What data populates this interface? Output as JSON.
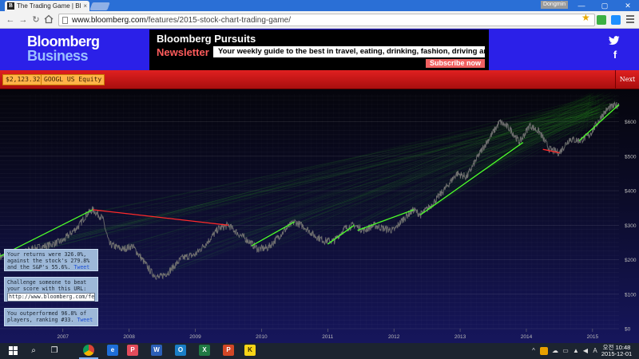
{
  "browser": {
    "tab_title": "The Trading Game | Bloo",
    "favicon_letter": "B",
    "tab_close": "×",
    "profile": "Dongmin",
    "url_host": "www.bloomberg.com",
    "url_path": "/features/2015-stock-chart-trading-game/",
    "back": "←",
    "forward": "→",
    "reload": "↻",
    "minimize": "—",
    "maximize": "▢",
    "close": "✕",
    "star": "★"
  },
  "site": {
    "logo_line1": "Bloomberg",
    "logo_line2": "Business",
    "twitter_icon": "t",
    "facebook_icon": "f"
  },
  "ad": {
    "title": "Bloomberg Pursuits",
    "subtitle": "Newsletter",
    "tagline": "Your weekly guide to the best in travel, eating, drinking, fashion, driving and living.",
    "button": "Subscribe now"
  },
  "game": {
    "balance": "$2,123.32",
    "ticker": "GOOGL US Equity",
    "next_label": "Next",
    "result": {
      "text_before": "Your returns were 326.0%, against the stock's 279.8% and the S&P's 55.6%.",
      "tweet": "Tweet"
    },
    "challenge": {
      "text": "Challenge someone to beat your score with this URL:",
      "url": "http://www.bloomberg.com/fe"
    },
    "outperformed": {
      "text": "You outperformed 96.8% of players, ranking #33.",
      "tweet": "Tweet"
    }
  },
  "chart_data": {
    "type": "line",
    "x_tick_labels": [
      "2007",
      "2008",
      "2009",
      "2010",
      "2011",
      "2012",
      "2013",
      "2014",
      "2015"
    ],
    "y_tick_labels": [
      "$0",
      "$100",
      "$200",
      "$300",
      "$400",
      "$500",
      "$600"
    ],
    "ylim": [
      0,
      680
    ],
    "xlim": [
      2006.55,
      2015.9
    ],
    "grid": true,
    "price_series": {
      "name": "",
      "x": [
        2006.55,
        2006.75,
        2007.0,
        2007.25,
        2007.5,
        2007.75,
        2007.85,
        2007.95,
        2008.1,
        2008.2,
        2008.4,
        2008.55,
        2008.7,
        2008.85,
        2008.95,
        2009.1,
        2009.3,
        2009.5,
        2009.7,
        2009.85,
        2010.0,
        2010.15,
        2010.3,
        2010.45,
        2010.6,
        2010.75,
        2010.9,
        2011.0,
        2011.15,
        2011.3,
        2011.45,
        2011.6,
        2011.75,
        2011.9,
        2012.05,
        2012.2,
        2012.35,
        2012.5,
        2012.65,
        2012.8,
        2012.9,
        2013.05,
        2013.25,
        2013.45,
        2013.6,
        2013.8,
        2013.95,
        2014.1,
        2014.25,
        2014.4,
        2014.55,
        2014.7,
        2014.85,
        2015.0,
        2015.15,
        2015.3,
        2015.45,
        2015.55,
        2015.65,
        2015.75,
        2015.9
      ],
      "y": [
        210,
        205,
        230,
        240,
        255,
        300,
        330,
        345,
        320,
        245,
        230,
        240,
        200,
        160,
        148,
        165,
        205,
        215,
        255,
        290,
        300,
        275,
        255,
        230,
        235,
        265,
        295,
        310,
        295,
        270,
        255,
        255,
        290,
        300,
        285,
        300,
        290,
        285,
        320,
        345,
        330,
        355,
        400,
        450,
        440,
        510,
        555,
        600,
        580,
        540,
        590,
        570,
        520,
        510,
        550,
        545,
        560,
        590,
        620,
        640,
        650
      ]
    },
    "trades": [
      {
        "x0": 2006.55,
        "y0": 210,
        "x1": 2007.95,
        "y1": 345,
        "result": "gain"
      },
      {
        "x0": 2007.95,
        "y0": 345,
        "x1": 2010.0,
        "y1": 300,
        "result": "loss"
      },
      {
        "x0": 2010.35,
        "y0": 240,
        "x1": 2011.0,
        "y1": 310,
        "result": "gain"
      },
      {
        "x0": 2011.5,
        "y0": 245,
        "x1": 2011.9,
        "y1": 300,
        "result": "gain"
      },
      {
        "x0": 2011.95,
        "y0": 285,
        "x1": 2012.8,
        "y1": 345,
        "result": "gain"
      },
      {
        "x0": 2012.9,
        "y0": 330,
        "x1": 2014.45,
        "y1": 540,
        "result": "gain"
      },
      {
        "x0": 2014.75,
        "y0": 520,
        "x1": 2015.0,
        "y1": 510,
        "result": "loss"
      },
      {
        "x0": 2015.3,
        "y0": 545,
        "x1": 2015.9,
        "y1": 650,
        "result": "gain"
      }
    ]
  },
  "taskbar": {
    "start_icon": "windows-logo",
    "search_icon": "⌕",
    "taskview_icon": "❐",
    "apps": [
      "Chrome",
      "e",
      "P",
      "W",
      "O",
      "X",
      "P",
      "K"
    ],
    "tray_chevron": "^",
    "time": "10:48",
    "period": "오전",
    "date": "2015-12-01"
  },
  "colors": {
    "header_blue": "#2b20e8",
    "gamebar_red": "#c41616",
    "gain": "#4dff2a",
    "loss": "#ff2a2a",
    "price": "#6f6f6f"
  }
}
